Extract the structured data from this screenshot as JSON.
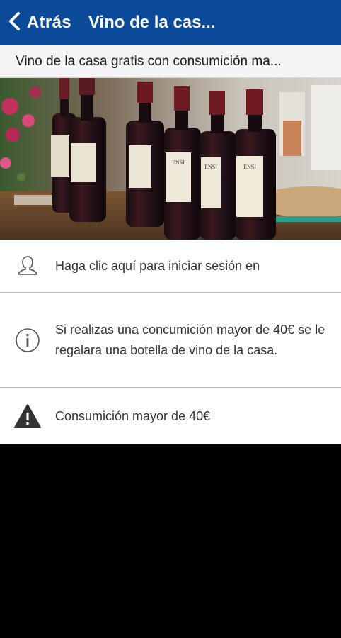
{
  "header": {
    "back_label": "Atrás",
    "title": "Vino de la cas..."
  },
  "subtitle": "Vino de la casa gratis con consumición ma...",
  "hero": {
    "bottle_labels": [
      "ENSI",
      "ENSI",
      "ENSI"
    ]
  },
  "rows": [
    {
      "icon": "user-outline-icon",
      "text": "Haga clic aquí para iniciar sesión en"
    },
    {
      "icon": "info-circle-icon",
      "text": "Si realizas una concumición mayor de 40€ se le regalara una botella de vino de la casa."
    },
    {
      "icon": "warning-triangle-icon",
      "text": "Consumición mayor de 40€"
    }
  ],
  "colors": {
    "header": "#0b4a98",
    "subtitle_bg": "#f4f4f4",
    "row_bg": "#ffffff",
    "text": "#333333"
  }
}
